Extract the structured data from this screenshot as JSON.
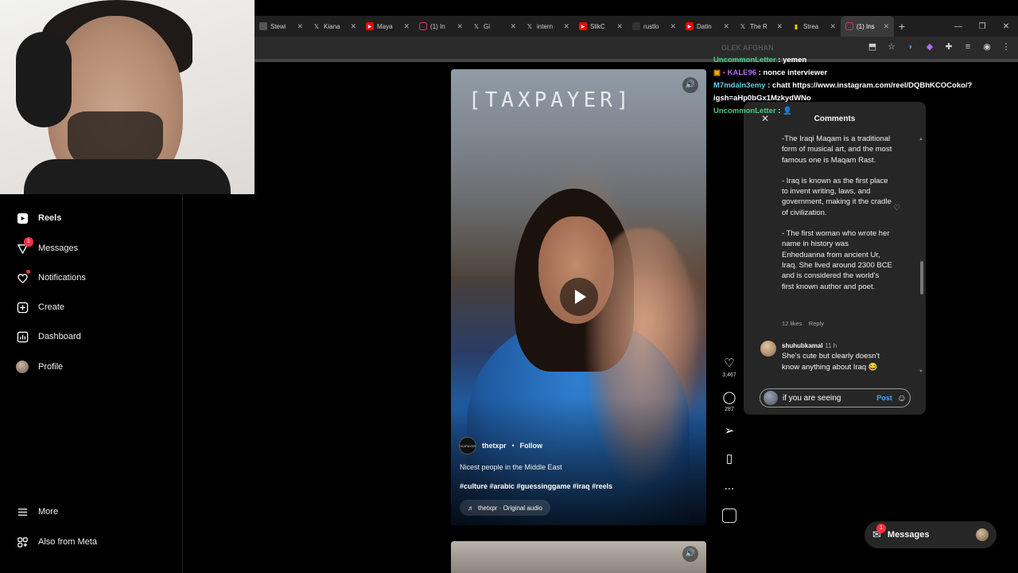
{
  "browser": {
    "tabs": [
      {
        "label": "Stewi",
        "icon": "tab-icon",
        "color": "#cccccc"
      },
      {
        "label": "Kiana",
        "icon": "x-icon",
        "color": "#ffffff"
      },
      {
        "label": "Maya",
        "icon": "youtube-icon",
        "color": "#ff0000"
      },
      {
        "label": "(1) In",
        "icon": "instagram-icon",
        "color": "#e1306c"
      },
      {
        "label": "Gi",
        "icon": "x-icon",
        "color": "#ffffff"
      },
      {
        "label": "intern",
        "icon": "x-icon",
        "color": "#ffffff"
      },
      {
        "label": "SlikC",
        "icon": "youtube-icon",
        "color": "#ff0000"
      },
      {
        "label": "rustlo",
        "icon": "tab-icon",
        "color": "#888888"
      },
      {
        "label": "Datin",
        "icon": "youtube-icon",
        "color": "#ff0000"
      },
      {
        "label": "The R",
        "icon": "x-icon",
        "color": "#ffffff"
      },
      {
        "label": "Strea",
        "icon": "chart-icon",
        "color": "#f2c200"
      },
      {
        "label": "(1) Ins",
        "icon": "instagram-icon",
        "color": "#e1306c",
        "active": true
      }
    ],
    "new_tab": "+",
    "window_controls": {
      "minimize": "—",
      "maximize": "❐",
      "close": "✕"
    }
  },
  "nav": {
    "items": [
      {
        "label": "Reels",
        "icon": "reels-icon"
      },
      {
        "label": "Messages",
        "icon": "messages-icon",
        "badge": "1"
      },
      {
        "label": "Notifications",
        "icon": "heart-icon"
      },
      {
        "label": "Create",
        "icon": "plus-square-icon"
      },
      {
        "label": "Dashboard",
        "icon": "dashboard-icon"
      },
      {
        "label": "Profile",
        "icon": "avatar"
      }
    ],
    "more": "More",
    "meta": "Also from Meta"
  },
  "reel": {
    "brand": "[TAXPAYER]",
    "username": "thetxpr",
    "separator": "•",
    "follow": "Follow",
    "avatar_text": "TAXPAYER",
    "caption": "Nicest people in the Middle East",
    "tags": "#culture #arabic #guessinggame #iraq #reels",
    "audio": "thetxpr · Original audio",
    "likes": "3,467",
    "comments": "287",
    "more": "..."
  },
  "chat": [
    {
      "user": "UncommonLetter",
      "msg": " : yemen",
      "color": "u1"
    },
    {
      "user": "KALE96",
      "msg": " : nonce interviewer",
      "color": "u2"
    },
    {
      "user": "M7mdaln3emy",
      "msg": " : chatt https://www.instagram.com/reel/DQBhKCOCoko/?igsh=aHp0bGx1MzkydWNo",
      "color": "u3"
    },
    {
      "user": "UncommonLetter",
      "msg": " : ",
      "color": "u1"
    }
  ],
  "chat_ghost": "GLEK AFGHAN",
  "comments_panel": {
    "title": "Comments",
    "close": "✕",
    "paragraphs": [
      "-The Iraqi Maqam is a traditional form of musical art, and the most famous one is Maqam Rast.",
      "- Iraq is known as the first place to invent writing, laws, and government, making it the cradle of civilization.",
      "- The first woman who wrote her name in history was Enheduanna from ancient Ur, Iraq. She lived around 2300 BCE and is considered the world's first known author and poet."
    ],
    "likes": "12 likes",
    "reply": "Reply",
    "second_comment": {
      "user": "shuhubkamal",
      "time": "11 h",
      "text": "She's cute but clearly doesn't know anything about Iraq 😂"
    },
    "input_value": "if you are seeing",
    "post": "Post"
  },
  "messages_pill": {
    "label": "Messages",
    "badge": "1"
  }
}
